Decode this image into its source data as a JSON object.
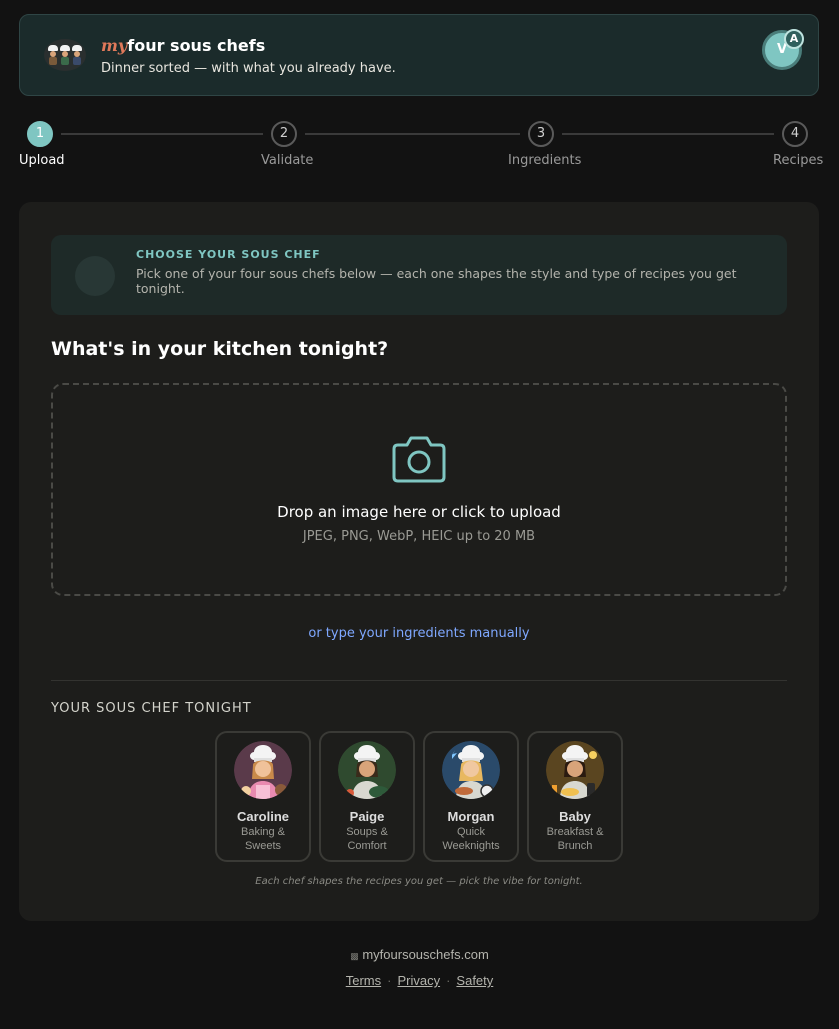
{
  "header": {
    "brand_prefix": "my",
    "brand_name": "four sous chefs",
    "tagline": "Dinner sorted — with what you already have.",
    "avatar_initial": "V",
    "avatar_badge": "A"
  },
  "stepper": {
    "steps": [
      {
        "number": "1",
        "label": "Upload",
        "active": true
      },
      {
        "number": "2",
        "label": "Validate",
        "active": false
      },
      {
        "number": "3",
        "label": "Ingredients",
        "active": false
      },
      {
        "number": "4",
        "label": "Recipes",
        "active": false
      }
    ]
  },
  "info": {
    "title": "CHOOSE YOUR SOUS CHEF",
    "text": "Pick one of your four sous chefs below — each one shapes the style and type of recipes you get tonight."
  },
  "upload": {
    "title": "What's in your kitchen tonight?",
    "drop_text": "Drop an image here or click to upload",
    "drop_sub": "JPEG, PNG, WebP, HEIC up to 20 MB",
    "manual_link": "or type your ingredients manually"
  },
  "chefs": {
    "section_title": "YOUR SOUS CHEF TONIGHT",
    "caption": "Each chef shapes the recipes you get — pick the vibe for tonight.",
    "items": [
      {
        "name": "Caroline",
        "desc": "Baking & Sweets",
        "bg": "#5a3a4a",
        "apron": "#e88ab0"
      },
      {
        "name": "Paige",
        "desc": "Soups & Comfort",
        "bg": "#2f4a2f",
        "apron": "#d8d8d0"
      },
      {
        "name": "Morgan",
        "desc": "Quick Weeknights",
        "bg": "#2a4a6a",
        "apron": "#d8d8d0"
      },
      {
        "name": "Baby",
        "desc": "Breakfast & Brunch",
        "bg": "#5a4520",
        "apron": "#d8d8d0"
      }
    ]
  },
  "footer": {
    "site": "myfoursouschefs.com",
    "links": [
      "Terms",
      "Privacy",
      "Safety"
    ]
  },
  "colors": {
    "accent": "#7fc6c2",
    "link": "#7fa8ff",
    "brand_prefix": "#e0795a"
  }
}
